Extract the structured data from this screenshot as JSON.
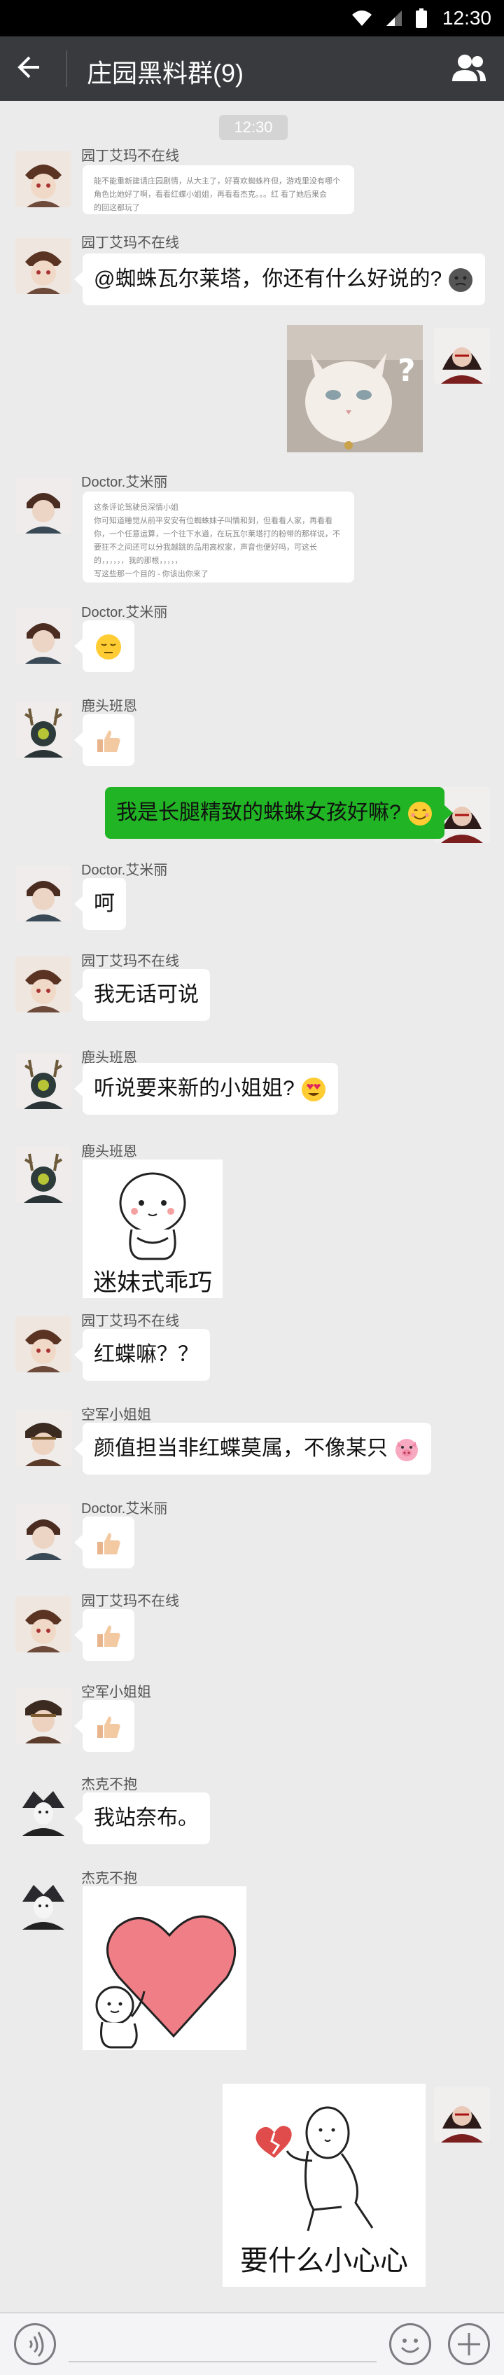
{
  "status_bar": {
    "time": "12:30"
  },
  "nav": {
    "title": "庄园黑料群(9)"
  },
  "timestamp": "12:30",
  "messages": [
    {
      "sender": "园丁艾玛不在线",
      "type": "text_image",
      "lines": [
        "能不能重新建请庄园剧情，从大主了，好喜欢蜘蛛杵但，游戏里没有哪个",
        "角色比她好了啊，看看红蝶小姐姐，再看看杰克。。。红 看了她后果会",
        "的回这都玩了"
      ]
    },
    {
      "sender": "园丁艾玛不在线",
      "text": "@蜘蛛瓦尔莱塔，你还有什么好说的?"
    },
    {
      "sender": "",
      "type": "image_cat"
    },
    {
      "sender": "Doctor.艾米丽",
      "type": "text_image",
      "lines": [
        "这条评论驾驶员深情小姐",
        "你可知道睡觉从前平安安有位蜘蛛妹子叫情和到，但看看人家，再看看",
        "你，一个任意运算，一个往下水道，在玩瓦尔莱塔打的粉带的那样说，不",
        "要狂不之间还可以分我越跳的品用高权家，声音也便好吗，可这长",
        "的，，，，，，我的那根，，，，，",
        "写这些那一个目的 - 你该出你来了"
      ]
    },
    {
      "sender": "Doctor.艾米丽",
      "type": "emoji_sigh"
    },
    {
      "sender": "鹿头班恩",
      "type": "thumb"
    },
    {
      "sender": "",
      "text": "我是长腿精致的蛛蛛女孩好嘛?"
    },
    {
      "sender": "Doctor.艾米丽",
      "text": "呵"
    },
    {
      "sender": "园丁艾玛不在线",
      "text": "我无话可说"
    },
    {
      "sender": "鹿头班恩",
      "text": "听说要来新的小姐姐?"
    },
    {
      "sender": "鹿头班恩",
      "type": "sticker",
      "caption": "迷妹式乖巧"
    },
    {
      "sender": "园丁艾玛不在线",
      "text": "红蝶嘛？？"
    },
    {
      "sender": "空军小姐姐",
      "text": "颜值担当非红蝶莫属，不像某只"
    },
    {
      "sender": "Doctor.艾米丽",
      "type": "thumb"
    },
    {
      "sender": "园丁艾玛不在线",
      "type": "thumb"
    },
    {
      "sender": "空军小姐姐",
      "type": "thumb"
    },
    {
      "sender": "杰克不抱",
      "text": "我站奈布。"
    },
    {
      "sender": "杰克不抱",
      "type": "sticker_heart"
    },
    {
      "sender": "",
      "type": "sticker",
      "caption": "要什么小心心"
    }
  ],
  "icons": {
    "back": "back-arrow-icon",
    "group": "group-members-icon",
    "wifi": "wifi-icon",
    "signal": "signal-icon",
    "battery": "battery-icon",
    "voice": "voice-icon",
    "emoji": "emoji-icon",
    "plus": "plus-icon"
  },
  "colors": {
    "nav_bg": "#393a3e",
    "chat_bg": "#ebebeb",
    "my_bubble": "#21b424"
  }
}
